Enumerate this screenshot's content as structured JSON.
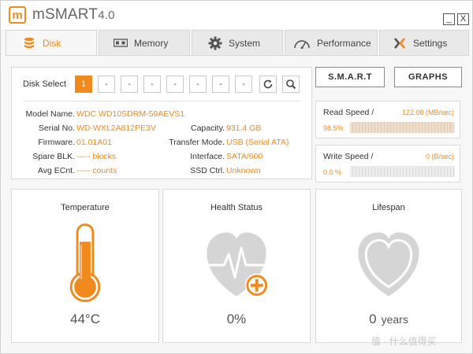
{
  "app": {
    "logo_letter": "m",
    "title": "mSMART",
    "version": "4.0",
    "minimize_label": "_",
    "close_label": "X"
  },
  "tabs": [
    {
      "label": "Disk",
      "icon": "disk-stack-icon",
      "active": true
    },
    {
      "label": "Memory",
      "icon": "memory-chip-icon",
      "active": false
    },
    {
      "label": "System",
      "icon": "gear-icon",
      "active": false
    },
    {
      "label": "Performance",
      "icon": "speedometer-icon",
      "active": false
    },
    {
      "label": "Settings",
      "icon": "settings-x-icon",
      "active": false
    }
  ],
  "disk_select": {
    "label": "Disk Select",
    "boxes": [
      "1",
      "-",
      "-",
      "-",
      "-",
      "-",
      "-",
      "-"
    ],
    "selected_index": 0,
    "refresh_icon": "refresh-icon",
    "search_icon": "search-icon"
  },
  "disk_info": {
    "model_label": "Model Name.",
    "model_value": "WDC WD10SDRM-59AEVS1",
    "serial_label": "Serial No.",
    "serial_value": "WD-WXL2A812PE3V",
    "firmware_label": "Firmware.",
    "firmware_value": "01.01A01",
    "spare_label": "Spare BLK.",
    "spare_value": "----- blocks",
    "avg_label": "Avg ECnt.",
    "avg_value": "----- counts",
    "capacity_label": "Capacity.",
    "capacity_value": "931.4 GB",
    "transfer_label": "Transfer Mode.",
    "transfer_value": "USB (Serial ATA)",
    "interface_label": "Interface.",
    "interface_value": "SATA/600",
    "ssd_label": "SSD Ctrl.",
    "ssd_value": "Unknown"
  },
  "buttons": {
    "smart": "S.M.A.R.T",
    "graphs": "GRAPHS"
  },
  "read_speed": {
    "label": "Read Speed /",
    "value": "122.08 (MB/sec)",
    "percent": "98.5%",
    "fill_fraction": 0.985
  },
  "write_speed": {
    "label": "Write Speed /",
    "value": "0 (B/sec)",
    "percent": "0.0 %",
    "fill_fraction": 0.0
  },
  "temperature": {
    "title": "Temperature",
    "value": "44°C",
    "icon": "thermometer-icon"
  },
  "health": {
    "title": "Health Status",
    "value": "0%",
    "icon": "heart-health-plus-icon"
  },
  "lifespan": {
    "title": "Lifespan",
    "value": "0",
    "unit": "years",
    "icon": "heart-icon"
  },
  "colors": {
    "accent": "#f08a1c",
    "icon_gray": "#d0d0d0",
    "text": "#333333"
  },
  "watermark": "值 · 什么值得买"
}
